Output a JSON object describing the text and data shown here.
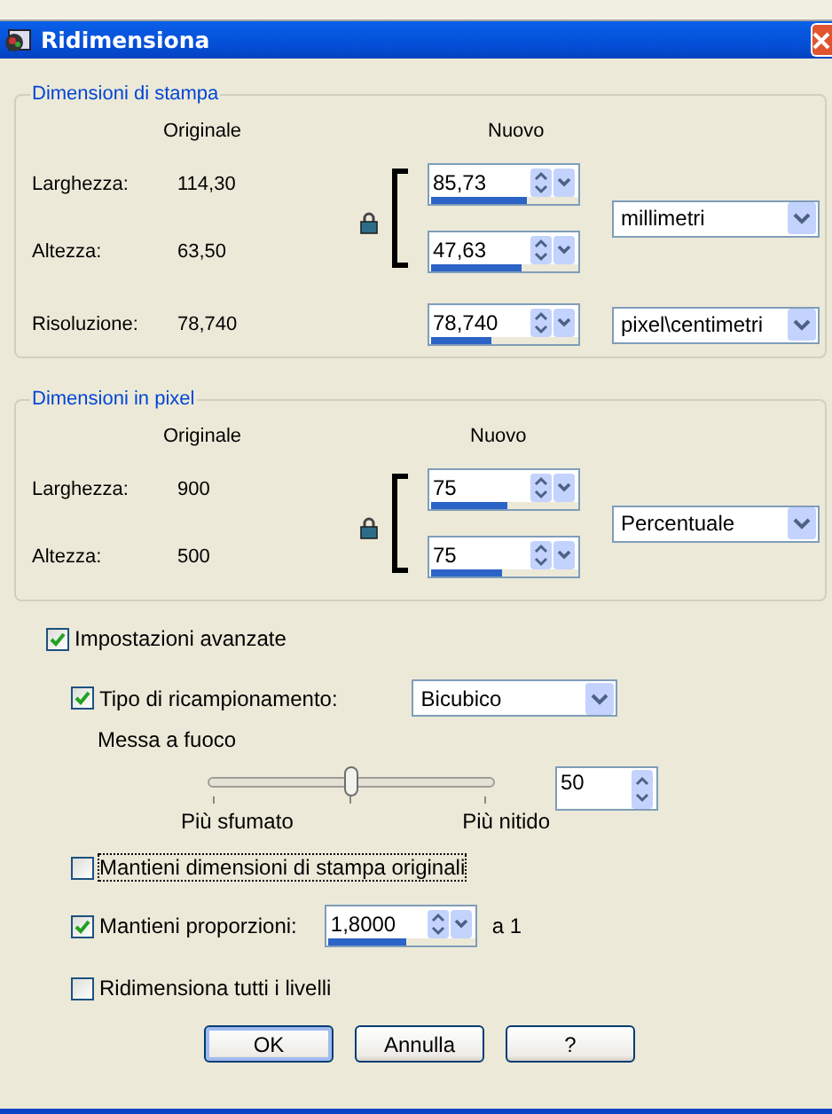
{
  "window": {
    "title": "Ridimensiona"
  },
  "print_size": {
    "title": "Dimensioni di stampa",
    "header_original": "Originale",
    "header_new": "Nuovo",
    "rows": [
      {
        "label": "Larghezza:",
        "original": "114,30",
        "value": "85,73",
        "level": 0.65
      },
      {
        "label": "Altezza:",
        "original": "63,50",
        "value": "47,63",
        "level": 0.62
      }
    ],
    "unit": "millimetri",
    "resolution": {
      "label": "Risoluzione:",
      "original": "78,740",
      "value": "78,740",
      "level": 0.41,
      "unit": "pixel\\centimetri"
    }
  },
  "pixel_size": {
    "title": "Dimensioni in pixel",
    "header_original": "Originale",
    "header_new": "Nuovo",
    "rows": [
      {
        "label": "Larghezza:",
        "original": "900",
        "value": "75",
        "level": 0.52
      },
      {
        "label": "Altezza:",
        "original": "500",
        "value": "75",
        "level": 0.48
      }
    ],
    "unit": "Percentuale"
  },
  "advanced": {
    "label": "Impostazioni avanzate",
    "checked": true
  },
  "resample": {
    "label": "Tipo di ricampionamento:",
    "checked": true,
    "value": "Bicubico"
  },
  "sharpness": {
    "label": "Messa a fuoco",
    "level": 0.5,
    "value": "50",
    "left_label": "Più sfumato",
    "right_label": "Più nitido"
  },
  "keep_print_size": {
    "label": "Mantieni dimensioni di stampa originali",
    "checked": false
  },
  "keep_ratio": {
    "label": "Mantieni proporzioni:",
    "checked": true,
    "value": "1,8000",
    "level": 0.53,
    "suffix": "a 1"
  },
  "resize_all_layers": {
    "label": "Ridimensiona tutti i livelli",
    "checked": false
  },
  "buttons": [
    {
      "label": "OK",
      "default": true
    },
    {
      "label": "Annulla",
      "default": false
    },
    {
      "label": "?",
      "default": false
    }
  ]
}
